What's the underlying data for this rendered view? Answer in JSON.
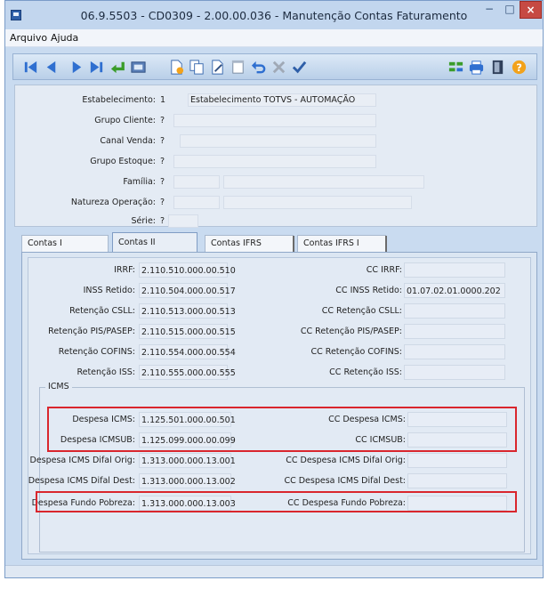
{
  "window": {
    "title": "06.9.5503 - CD0309 - 2.00.00.036 - Manutenção Contas Faturamento",
    "minimize": "−",
    "maximize": "□",
    "close": "×"
  },
  "menu": {
    "items": [
      {
        "label": "Arquivo"
      },
      {
        "label": "Ajuda"
      }
    ]
  },
  "toolbar": {
    "icons": [
      "first-record-icon",
      "previous-record-icon",
      "next-record-icon",
      "last-record-icon",
      "goto-icon",
      "search-icon",
      "new-record-icon",
      "copy-icon",
      "edit-icon",
      "delete-icon",
      "undo-icon",
      "cancel-icon",
      "confirm-icon",
      "navigation-icon",
      "print-icon",
      "exit-icon",
      "help-icon"
    ]
  },
  "header": {
    "estabelecimento": {
      "label": "Estabelecimento:",
      "code": "1",
      "desc": "Estabelecimento TOTVS - AUTOMAÇÃO"
    },
    "grupo_cliente": {
      "label": "Grupo Cliente:",
      "code": "?"
    },
    "canal_venda": {
      "label": "Canal Venda:",
      "code": "?"
    },
    "grupo_estoque": {
      "label": "Grupo Estoque:",
      "code": "?"
    },
    "familia": {
      "label": "Família:",
      "code": "?"
    },
    "natureza_operacao": {
      "label": "Natureza Operação:",
      "code": "?"
    },
    "serie": {
      "label": "Série:",
      "code": "?"
    }
  },
  "tabs": [
    {
      "label": "Contas I",
      "active": false
    },
    {
      "label": "Contas II",
      "active": true
    },
    {
      "label": "Contas IFRS",
      "active": false
    },
    {
      "label": "Contas IFRS I",
      "active": false
    }
  ],
  "contas": {
    "irrf": {
      "label": "IRRF:",
      "value": "2.110.510.000.00.510"
    },
    "inss": {
      "label": "INSS Retido:",
      "value": "2.110.504.000.00.517"
    },
    "csll": {
      "label": "Retenção CSLL:",
      "value": "2.110.513.000.00.513"
    },
    "pis": {
      "label": "Retenção PIS/PASEP:",
      "value": "2.110.515.000.00.515"
    },
    "cofins": {
      "label": "Retenção COFINS:",
      "value": "2.110.554.000.00.554"
    },
    "iss": {
      "label": "Retenção ISS:",
      "value": "2.110.555.000.00.555"
    },
    "cc_irrf": {
      "label": "CC IRRF:",
      "value": ""
    },
    "cc_inss": {
      "label": "CC INSS Retido:",
      "value": "01.07.02.01.0000.202"
    },
    "cc_csll": {
      "label": "CC Retenção CSLL:",
      "value": ""
    },
    "cc_pis": {
      "label": "CC Retenção PIS/PASEP:",
      "value": ""
    },
    "cc_cofins": {
      "label": "CC Retenção COFINS:",
      "value": ""
    },
    "cc_iss": {
      "label": "CC Retenção ISS:",
      "value": ""
    }
  },
  "icms": {
    "title": "ICMS",
    "despesa_icms": {
      "label": "Despesa ICMS:",
      "value": "1.125.501.000.00.501"
    },
    "despesa_icmssub": {
      "label": "Despesa ICMSUB:",
      "value": "1.125.099.000.00.099"
    },
    "difal_orig": {
      "label": "Despesa ICMS Difal Orig:",
      "value": "1.313.000.000.13.001"
    },
    "difal_dest": {
      "label": "Despesa ICMS Difal Dest:",
      "value": "1.313.000.000.13.002"
    },
    "fundo_pobreza": {
      "label": "Despesa Fundo Pobreza:",
      "value": "1.313.000.000.13.003"
    },
    "cc_despesa_icms": {
      "label": "CC Despesa ICMS:",
      "value": ""
    },
    "cc_icmsub": {
      "label": "CC ICMSUB:",
      "value": ""
    },
    "cc_difal_orig": {
      "label": "CC Despesa ICMS Difal Orig:",
      "value": ""
    },
    "cc_difal_dest": {
      "label": "CC Despesa ICMS Difal Dest:",
      "value": ""
    },
    "cc_fundo_pobreza": {
      "label": "CC Despesa Fundo Pobreza:",
      "value": ""
    }
  },
  "colors": {
    "highlight": "#d9262d",
    "window_frame": "#c9dbf0",
    "close_button": "#c64a43"
  }
}
